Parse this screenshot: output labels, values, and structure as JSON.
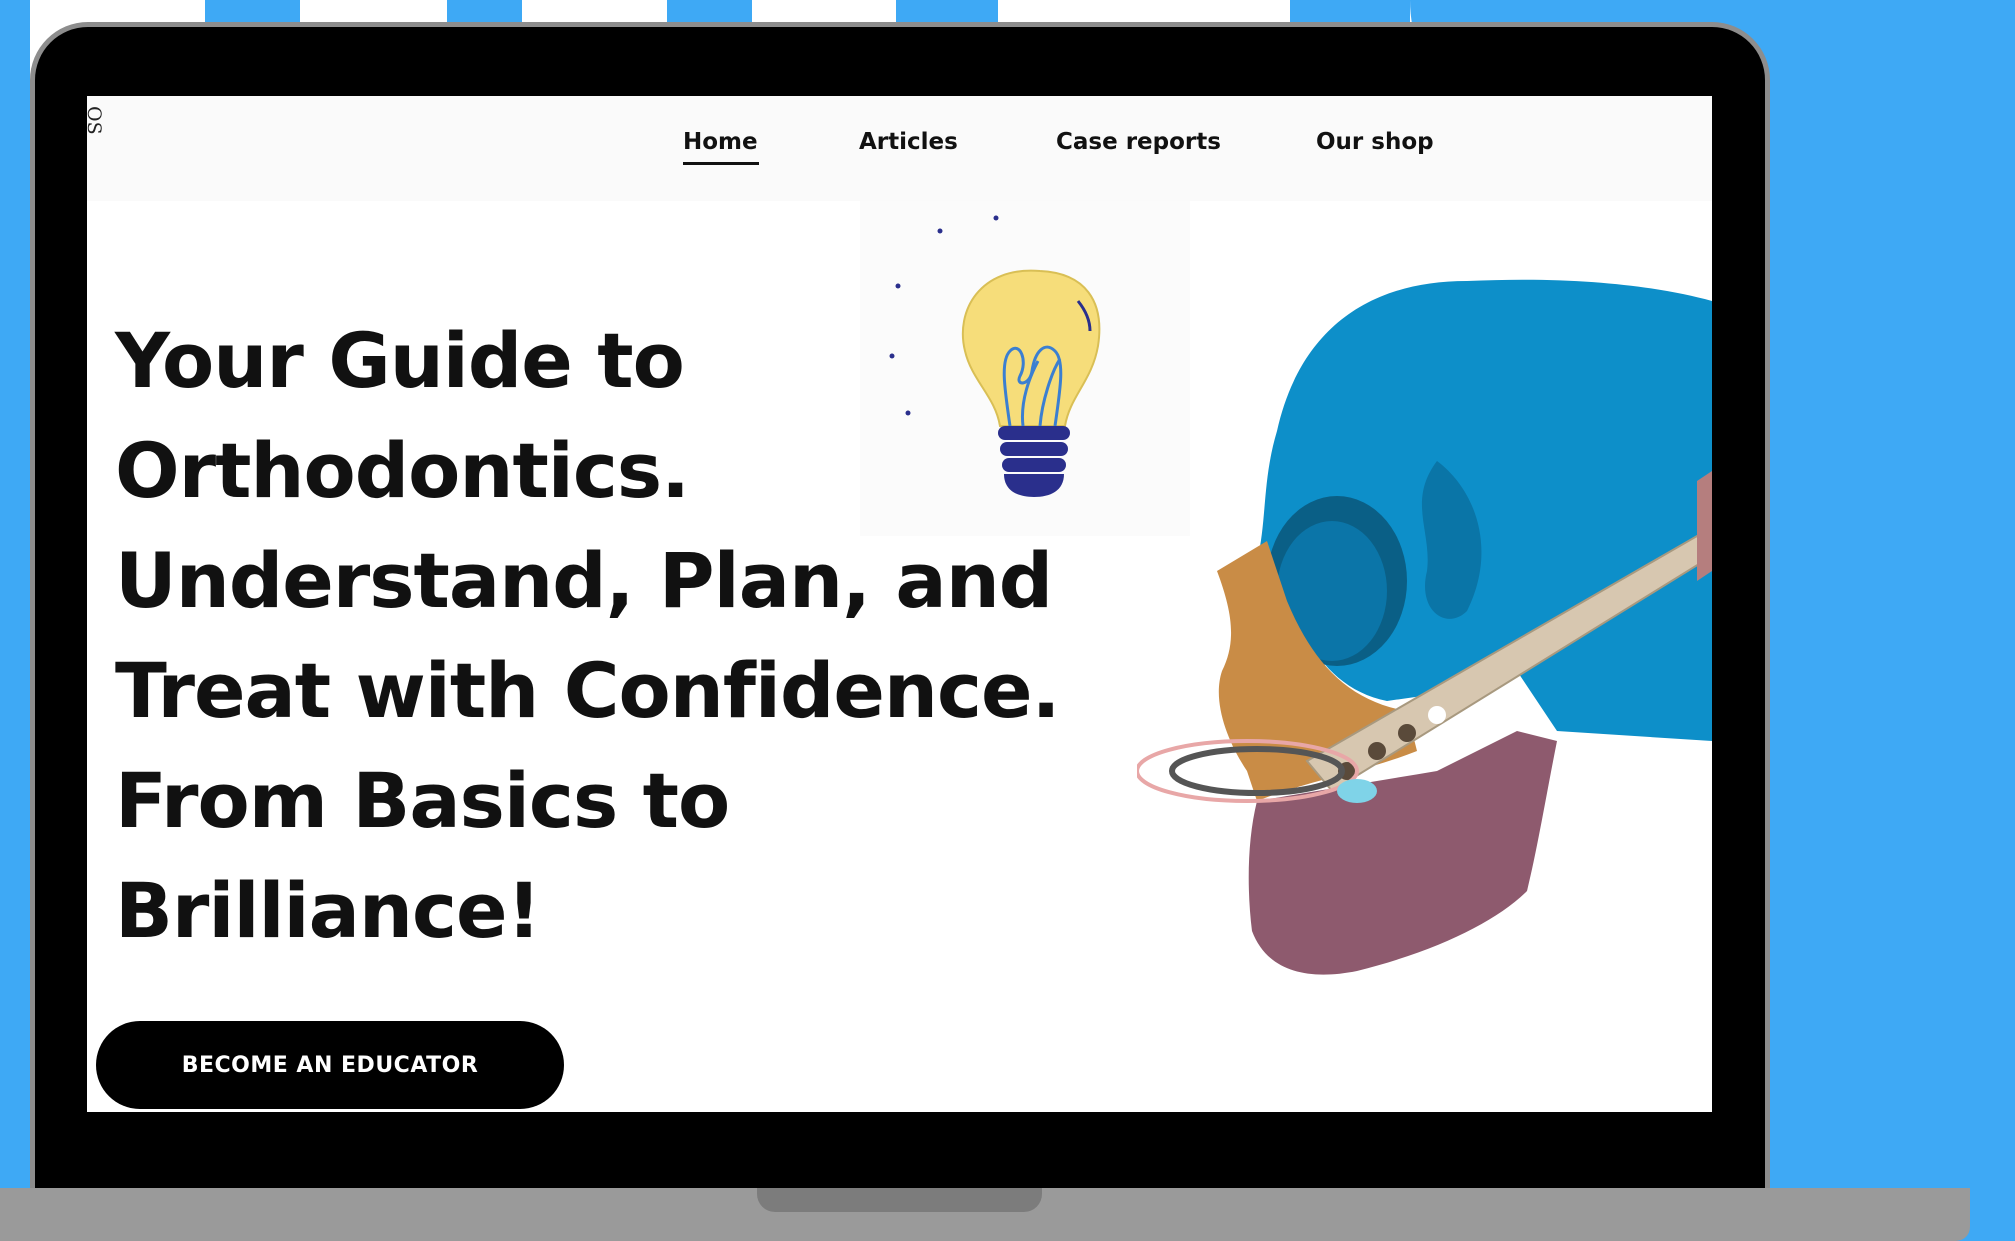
{
  "nav": {
    "items": [
      {
        "label": "Home",
        "active": true
      },
      {
        "label": "Articles",
        "active": false
      },
      {
        "label": "Case reports",
        "active": false
      },
      {
        "label": "Our shop",
        "active": false
      }
    ]
  },
  "logo": {
    "text": "OS"
  },
  "hero": {
    "title_lines": [
      "Your Guide to",
      "Orthodontics.",
      "Understand, Plan, and",
      "Treat with Confidence.",
      "From Basics to",
      "Brilliance!"
    ],
    "cta_label": "BECOME AN EDUCATOR"
  },
  "icons": {
    "lightbulb": "lightbulb-icon",
    "skull": "skull-illustration"
  },
  "colors": {
    "accent_blue": "#3ea9f5",
    "skull_blue": "#0d8fc9",
    "maxilla_orange": "#c98c46",
    "mandible_mauve": "#8e5a6e",
    "bulb_yellow": "#f6dd7a",
    "bulb_base_navy": "#2a2f8c"
  }
}
